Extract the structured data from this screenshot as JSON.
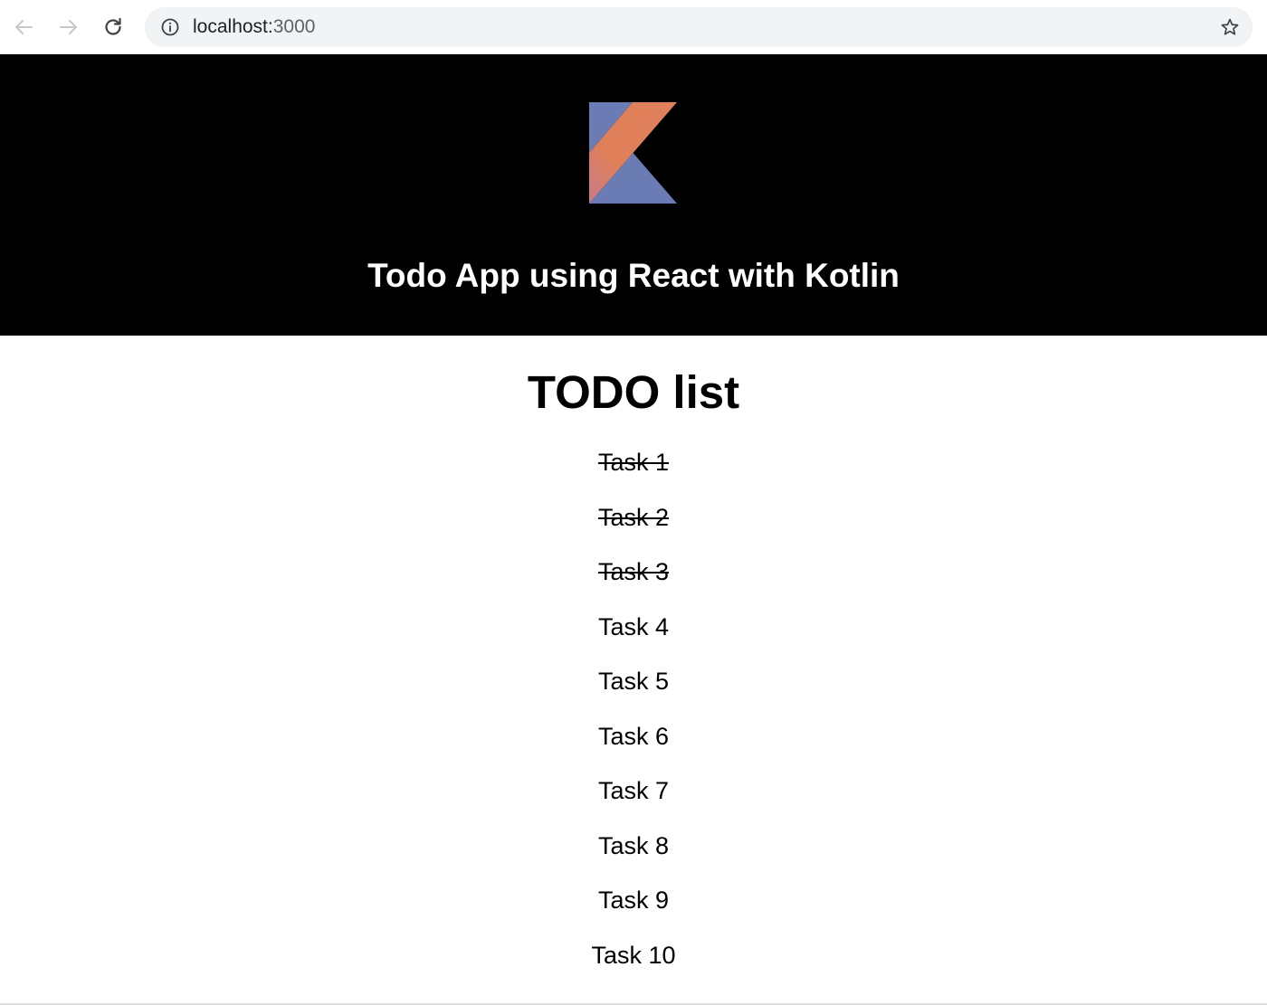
{
  "browser": {
    "url_host": "localhost:",
    "url_port": "3000"
  },
  "header": {
    "logo_icon": "kotlin-logo",
    "title": "Todo App using React with Kotlin",
    "background": "#000000",
    "logo_colors": {
      "blue": "#6b7bb4",
      "orange": "#e0805a"
    }
  },
  "main": {
    "heading": "TODO list",
    "tasks": [
      {
        "label": "Task 1",
        "completed": true
      },
      {
        "label": "Task 2",
        "completed": true
      },
      {
        "label": "Task 3",
        "completed": true
      },
      {
        "label": "Task 4",
        "completed": false
      },
      {
        "label": "Task 5",
        "completed": false
      },
      {
        "label": "Task 6",
        "completed": false
      },
      {
        "label": "Task 7",
        "completed": false
      },
      {
        "label": "Task 8",
        "completed": false
      },
      {
        "label": "Task 9",
        "completed": false
      },
      {
        "label": "Task 10",
        "completed": false
      }
    ]
  }
}
